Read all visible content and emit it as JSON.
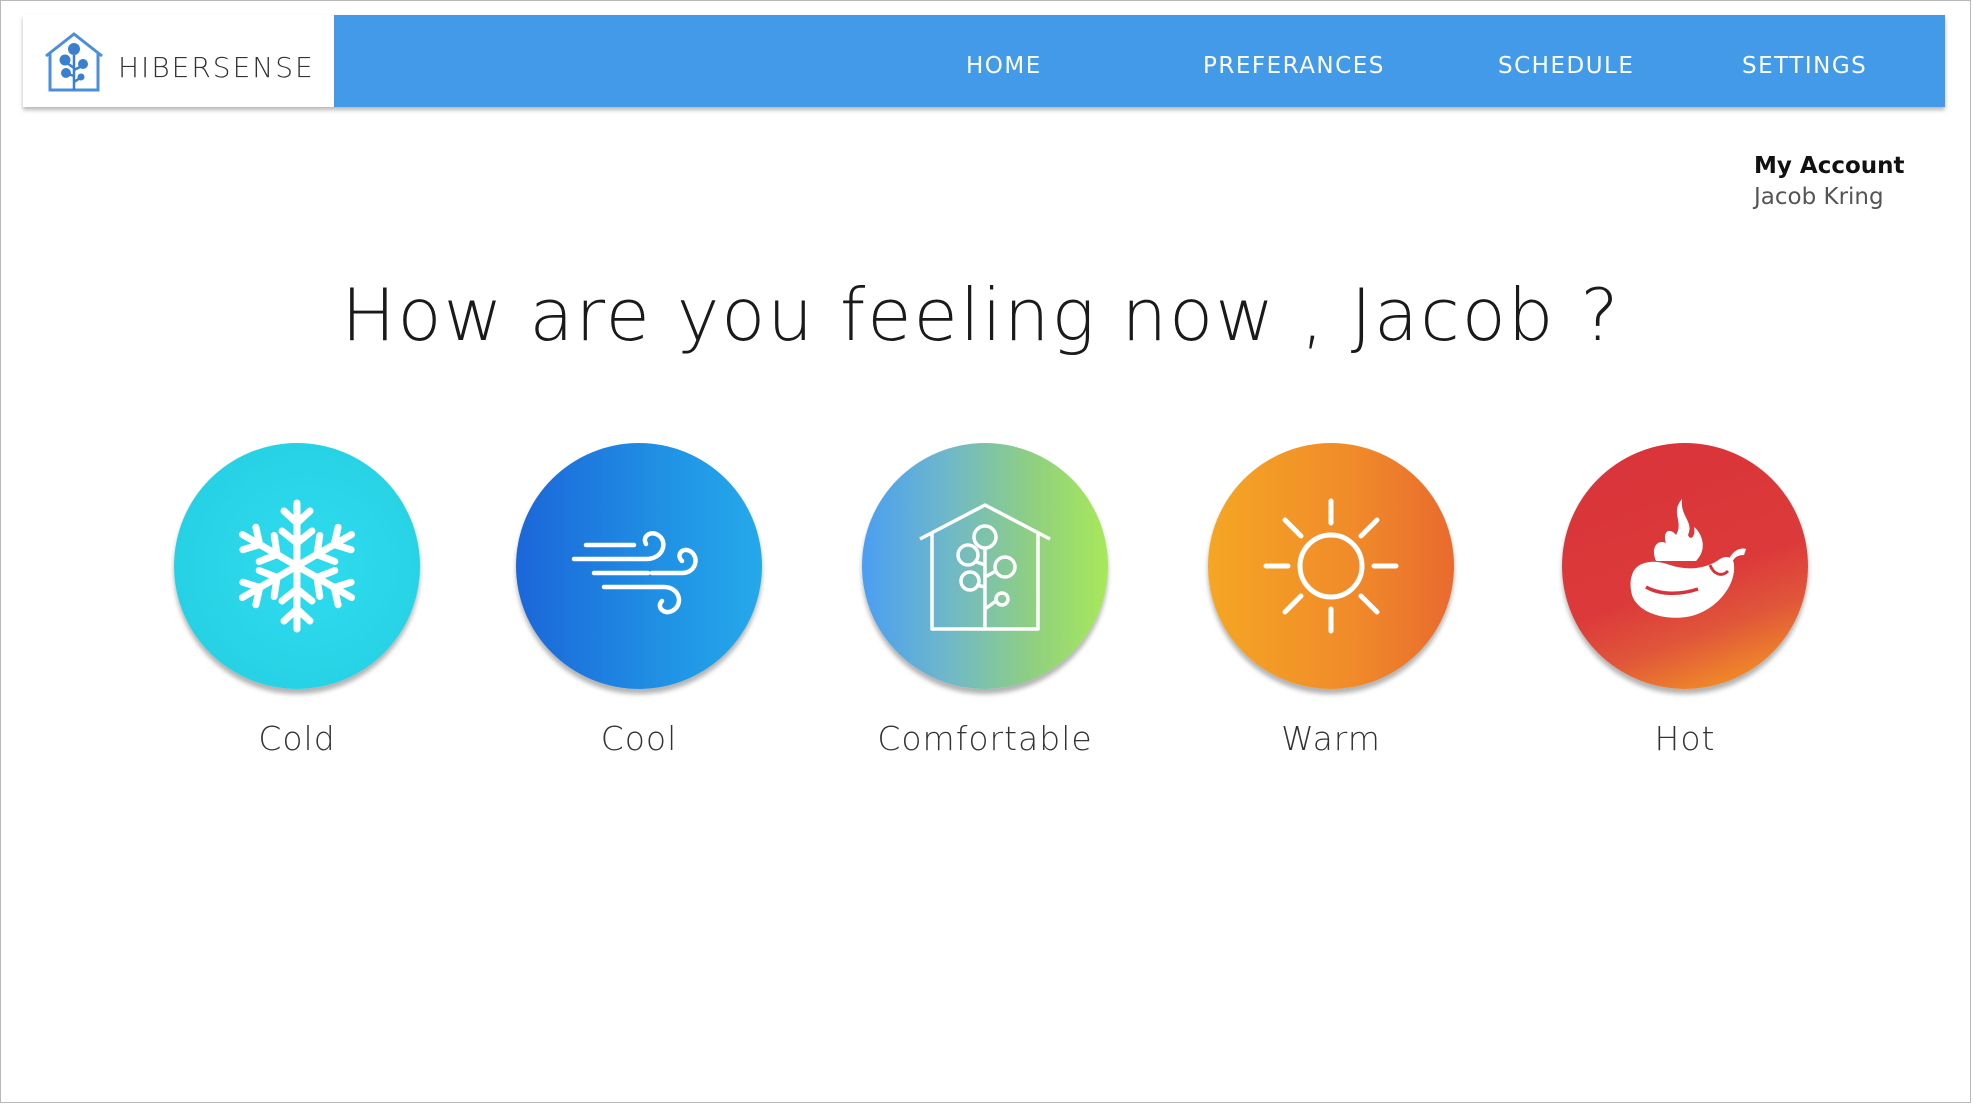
{
  "brand": {
    "name": "HIBERSENSE",
    "logo_icon": "house-tree-icon"
  },
  "nav": {
    "items": [
      {
        "label": "HOME"
      },
      {
        "label": "PREFERANCES"
      },
      {
        "label": "SCHEDULE"
      },
      {
        "label": "SETTINGS"
      }
    ],
    "color": "#439ae8"
  },
  "account": {
    "title": "My Account",
    "name": "Jacob Kring"
  },
  "headline": "How are you feeling now , Jacob ?",
  "options": [
    {
      "label": "Cold",
      "icon": "snowflake-icon"
    },
    {
      "label": "Cool",
      "icon": "wind-icon"
    },
    {
      "label": "Comfortable",
      "icon": "house-tree-icon"
    },
    {
      "label": "Warm",
      "icon": "sun-icon"
    },
    {
      "label": "Hot",
      "icon": "fire-pepper-icon"
    }
  ]
}
